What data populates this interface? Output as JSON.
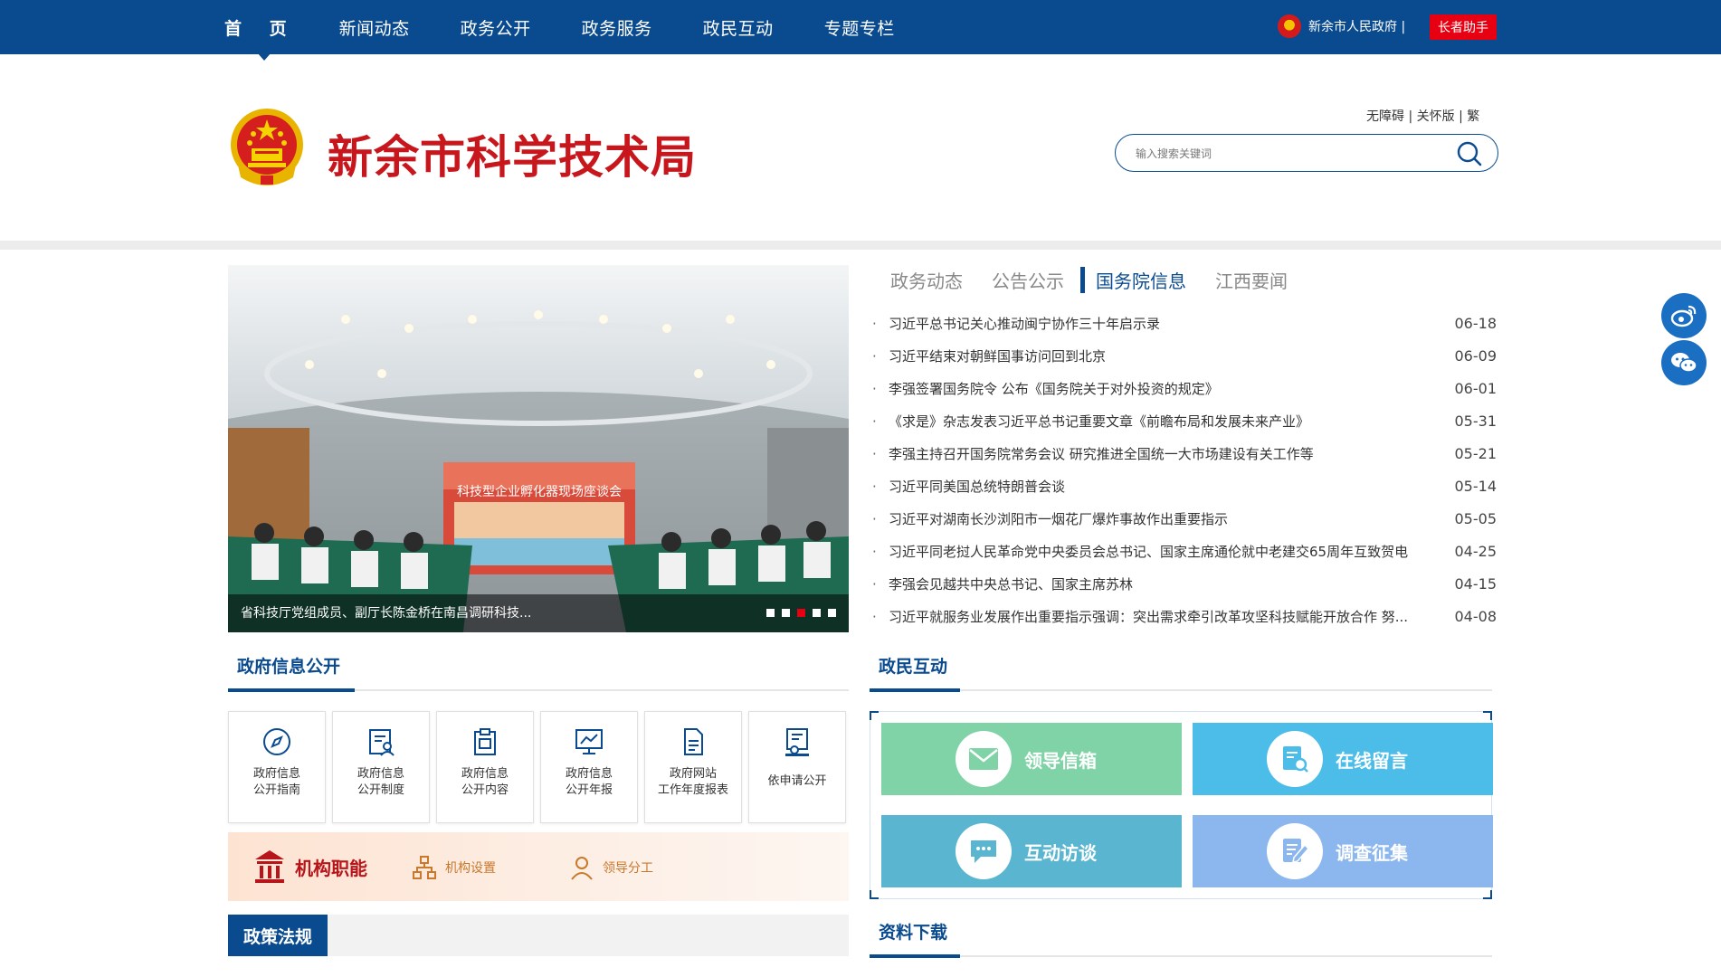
{
  "nav": {
    "items": [
      "首 页",
      "新闻动态",
      "政务公开",
      "政务服务",
      "政民互动",
      "专题专栏"
    ],
    "gov_link": "新余市人民政府 |",
    "elder_button": "长者助手"
  },
  "header": {
    "title": "新余市科学技术局",
    "access_links": "无障碍 | 关怀版 | 繁",
    "search_placeholder": "输入搜索关键词"
  },
  "carousel": {
    "caption": "省科技厅党组成员、副厅长陈金桥在南昌调研科技...",
    "screen_text": "科技型企业孵化器现场座谈会",
    "active_dot": 3
  },
  "news": {
    "tabs": [
      "政务动态",
      "公告公示",
      "国务院信息",
      "江西要闻"
    ],
    "active_tab": 2,
    "items": [
      {
        "title": "习近平总书记关心推动闽宁协作三十年启示录",
        "date": "06-18"
      },
      {
        "title": "习近平结束对朝鲜国事访问回到北京",
        "date": "06-09"
      },
      {
        "title": "李强签署国务院令 公布《国务院关于对外投资的规定》",
        "date": "06-01"
      },
      {
        "title": "《求是》杂志发表习近平总书记重要文章《前瞻布局和发展未来产业》",
        "date": "05-31"
      },
      {
        "title": "李强主持召开国务院常务会议 研究推进全国统一大市场建设有关工作等",
        "date": "05-21"
      },
      {
        "title": "习近平同美国总统特朗普会谈",
        "date": "05-14"
      },
      {
        "title": "习近平对湖南长沙浏阳市一烟花厂爆炸事故作出重要指示",
        "date": "05-05"
      },
      {
        "title": "习近平同老挝人民革命党中央委员会总书记、国家主席通伦就中老建交65周年互致贺电",
        "date": "04-25"
      },
      {
        "title": "李强会见越共中央总书记、国家主席苏林",
        "date": "04-15"
      },
      {
        "title": "习近平就服务业发展作出重要指示强调：突出需求牵引改革攻坚科技赋能开放合作 努...",
        "date": "04-08"
      }
    ]
  },
  "info_section": {
    "title": "政府信息公开",
    "cards": [
      {
        "label": "政府信息\n公开指南",
        "icon": "compass-icon"
      },
      {
        "label": "政府信息\n公开制度",
        "icon": "document-person-icon"
      },
      {
        "label": "政府信息\n公开内容",
        "icon": "clipboard-icon"
      },
      {
        "label": "政府信息\n公开年报",
        "icon": "chart-monitor-icon"
      },
      {
        "label": "政府网站\n工作年度报表",
        "icon": "file-icon"
      },
      {
        "label": "依申请公开",
        "icon": "form-icon"
      }
    ]
  },
  "org": {
    "main_label": "机构职能",
    "setup_label": "机构设置",
    "leader_label": "领导分工"
  },
  "policy": {
    "title": "政策法规"
  },
  "interaction": {
    "title": "政民互动",
    "tiles": [
      {
        "label": "领导信箱",
        "color": "#7fd3a6",
        "icon": "mail-icon"
      },
      {
        "label": "在线留言",
        "color": "#4cbde8",
        "icon": "message-search-icon"
      },
      {
        "label": "互动访谈",
        "color": "#5ab6d0",
        "icon": "chat-icon"
      },
      {
        "label": "调查征集",
        "color": "#8cb7ee",
        "icon": "survey-edit-icon"
      }
    ]
  },
  "downloads": {
    "title": "资料下载"
  },
  "colors": {
    "primary": "#0a4b8f",
    "title_red": "#c8161d",
    "elder_red": "#e60012"
  }
}
